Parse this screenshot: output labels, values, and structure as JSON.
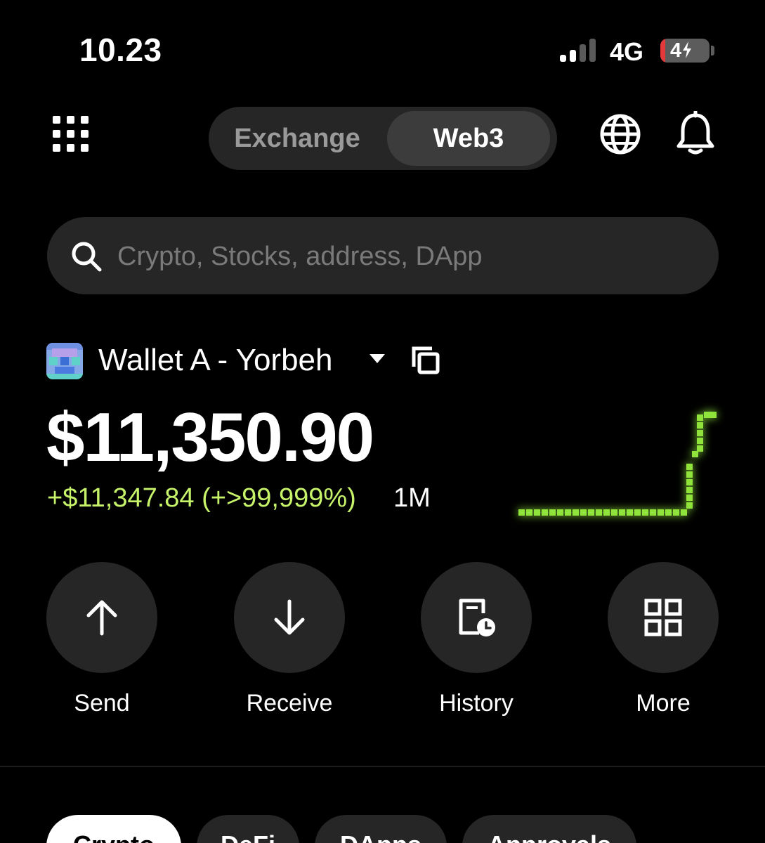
{
  "status_bar": {
    "time": "10.23",
    "network": "4G",
    "battery": "4"
  },
  "header": {
    "tabs": [
      "Exchange",
      "Web3"
    ],
    "active_tab": "Web3"
  },
  "search": {
    "placeholder": "Crypto, Stocks, address, DApp"
  },
  "wallet": {
    "name": "Wallet A - Yorbeh",
    "balance": "$11,350.90",
    "change": "+$11,347.84 (+>99,999%)",
    "period": "1M",
    "sparkline_color": "#8fe33b"
  },
  "actions": [
    {
      "label": "Send",
      "icon": "arrow-up-icon"
    },
    {
      "label": "Receive",
      "icon": "arrow-down-icon"
    },
    {
      "label": "History",
      "icon": "history-icon"
    },
    {
      "label": "More",
      "icon": "more-grid-icon"
    }
  ],
  "asset_tabs": [
    "Crypto",
    "DeFi",
    "DApps",
    "Approvals"
  ],
  "colors": {
    "background": "#000000",
    "surface": "#262626",
    "accent_green": "#c7f36a",
    "battery_low": "#e5393c"
  }
}
